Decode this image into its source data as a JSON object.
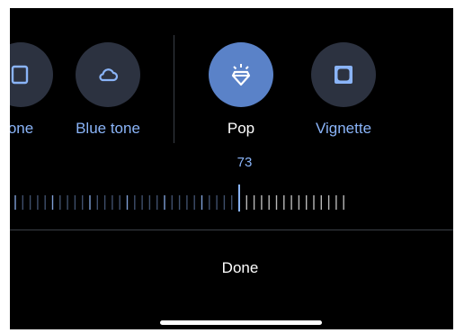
{
  "tools": [
    {
      "id": "partial",
      "label": "one",
      "icon": "tone-icon"
    },
    {
      "id": "blue-tone",
      "label": "Blue tone",
      "icon": "cloud-icon"
    },
    {
      "id": "pop",
      "label": "Pop",
      "icon": "diamond-sparkle-icon",
      "selected": true
    },
    {
      "id": "vignette",
      "label": "Vignette",
      "icon": "vignette-square-icon"
    }
  ],
  "adjustment": {
    "value": "73",
    "fraction": 0.73
  },
  "done_label": "Done",
  "colors": {
    "background": "#000000",
    "accent": "#8ab4f8",
    "active_circle": "#5a82c8",
    "inactive_circle": "#2c3240"
  }
}
